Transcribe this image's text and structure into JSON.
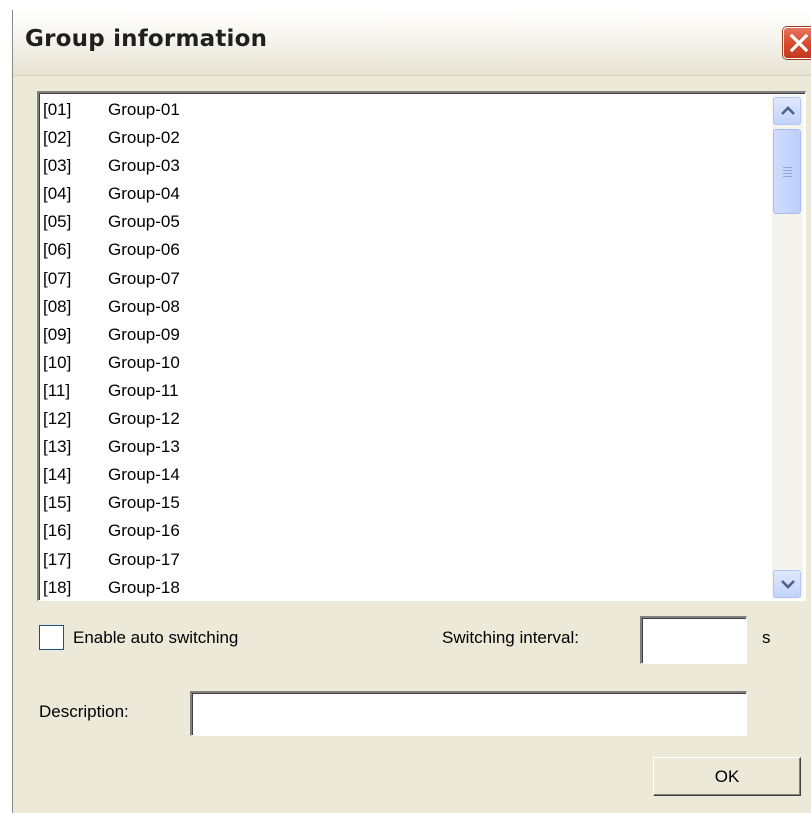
{
  "window": {
    "title": "Group information",
    "close_icon": "close-icon"
  },
  "groups": [
    {
      "num": "[01]",
      "name": "Group-01"
    },
    {
      "num": "[02]",
      "name": "Group-02"
    },
    {
      "num": "[03]",
      "name": "Group-03"
    },
    {
      "num": "[04]",
      "name": "Group-04"
    },
    {
      "num": "[05]",
      "name": "Group-05"
    },
    {
      "num": "[06]",
      "name": "Group-06"
    },
    {
      "num": "[07]",
      "name": "Group-07"
    },
    {
      "num": "[08]",
      "name": "Group-08"
    },
    {
      "num": "[09]",
      "name": "Group-09"
    },
    {
      "num": "[10]",
      "name": "Group-10"
    },
    {
      "num": "[11]",
      "name": "Group-11"
    },
    {
      "num": "[12]",
      "name": "Group-12"
    },
    {
      "num": "[13]",
      "name": "Group-13"
    },
    {
      "num": "[14]",
      "name": "Group-14"
    },
    {
      "num": "[15]",
      "name": "Group-15"
    },
    {
      "num": "[16]",
      "name": "Group-16"
    },
    {
      "num": "[17]",
      "name": "Group-17"
    },
    {
      "num": "[18]",
      "name": "Group-18"
    }
  ],
  "auto_switch": {
    "label": "Enable auto switching",
    "checked": false
  },
  "interval": {
    "label": "Switching interval:",
    "value": "",
    "unit": "s"
  },
  "description": {
    "label": "Description:",
    "value": ""
  },
  "buttons": {
    "ok": "OK"
  },
  "colors": {
    "dialog_bg": "#ece9d8",
    "close_red": "#d54a2c",
    "scroll_blue": "#c1d3fb"
  }
}
